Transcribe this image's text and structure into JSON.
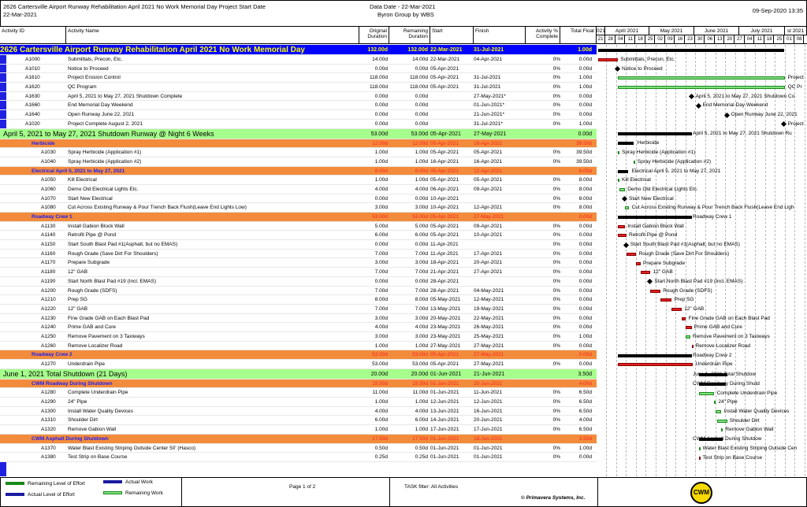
{
  "header": {
    "title": "2626 Cartersville Airport Runway Rehabilitation April 2021 No Work Memorial Day Project Start Date",
    "start_date": "22-Mar-2021",
    "data_date": "Data Date - 22-Mar-2021",
    "group": "Byron Group by WBS",
    "run_date": "09-Sep-2020 13:35"
  },
  "columns": {
    "id": "Activity ID",
    "name": "Activity Name",
    "orig": "Original Duration",
    "rem": "Remaining Duration",
    "start": "Start",
    "finish": "Finish",
    "pct": "Activity % Complete",
    "tf": "Total Float"
  },
  "timeline": {
    "months": [
      "021",
      "April 2021",
      "May 2021",
      "June 2021",
      "July 2021",
      "st 2021"
    ],
    "days": [
      "21",
      "28",
      "04",
      "11",
      "18",
      "25",
      "02",
      "09",
      "16",
      "23",
      "30",
      "06",
      "13",
      "20",
      "27",
      "04",
      "11",
      "18",
      "25",
      "01",
      "08"
    ]
  },
  "rows": [
    {
      "type": "proj",
      "id": "2626 Cartersville Airport Runway Rehabilitation April 2021 No Work Memorial Day",
      "od": "132.00d",
      "rd": "132.00d",
      "st": "22-Mar-2021",
      "fn": "31-Jul-2021",
      "pc": "",
      "tf": "1.00d"
    },
    {
      "type": "act",
      "id": "A1000",
      "nm": "Submittals, Precon, Etc.",
      "od": "14.00d",
      "rd": "14.00d",
      "st": "22-Mar-2021",
      "fn": "04-Apr-2021",
      "pc": "0%",
      "tf": "0.00d"
    },
    {
      "type": "act",
      "id": "A1010",
      "nm": "Notice to Proceed",
      "od": "0.00d",
      "rd": "0.00d",
      "st": "05-Apr-2021",
      "fn": "",
      "pc": "0%",
      "tf": "0.00d"
    },
    {
      "type": "act",
      "id": "A1610",
      "nm": "Project Erosion Control",
      "od": "118.00d",
      "rd": "118.00d",
      "st": "05-Apr-2021",
      "fn": "31-Jul-2021",
      "pc": "0%",
      "tf": "1.00d"
    },
    {
      "type": "act",
      "id": "A1620",
      "nm": "QC Program",
      "od": "118.00d",
      "rd": "118.00d",
      "st": "05-Apr-2021",
      "fn": "31-Jul-2021",
      "pc": "0%",
      "tf": "1.00d"
    },
    {
      "type": "act",
      "id": "A1630",
      "nm": "April 5, 2021 to May 27, 2021 Shutdown Complete",
      "od": "0.00d",
      "rd": "0.00d",
      "st": "",
      "fn": "27-May-2021*",
      "pc": "0%",
      "tf": "0.00d"
    },
    {
      "type": "act",
      "id": "A1660",
      "nm": "End Memorial Day Weekend",
      "od": "0.00d",
      "rd": "0.00d",
      "st": "",
      "fn": "01-Jun-2021*",
      "pc": "0%",
      "tf": "0.00d"
    },
    {
      "type": "act",
      "id": "A1640",
      "nm": "Open Runway June 22, 2021",
      "od": "0.00d",
      "rd": "0.00d",
      "st": "",
      "fn": "21-Jun-2021*",
      "pc": "0%",
      "tf": "0.00d"
    },
    {
      "type": "act",
      "id": "A1020",
      "nm": "Project Complete August 2, 2021",
      "od": "0.00d",
      "rd": "0.00d",
      "st": "",
      "fn": "31-Jul-2021*",
      "pc": "0%",
      "tf": "1.00d"
    },
    {
      "type": "l1",
      "id": "April 5, 2021 to May 27, 2021 Shutdown Runway @ Night 6 Weeks",
      "od": "53.00d",
      "rd": "53.00d",
      "st": "05-Apr-2021",
      "fn": "27-May-2021",
      "pc": "",
      "tf": "0.00d"
    },
    {
      "type": "l2",
      "id": "Herbicide",
      "od": "12.00d",
      "rd": "12.00d",
      "st": "05-Apr-2021",
      "fn": "16-Apr-2021",
      "pc": "",
      "tf": "39.50d"
    },
    {
      "type": "act2",
      "id": "A1030",
      "nm": "Spray Herbicide (Application #1)",
      "od": "1.00d",
      "rd": "1.00d",
      "st": "05-Apr-2021",
      "fn": "05-Apr-2021",
      "pc": "0%",
      "tf": "39.50d"
    },
    {
      "type": "act2",
      "id": "A1040",
      "nm": "Spray Herbicide (Application #2)",
      "od": "1.00d",
      "rd": "1.00d",
      "st": "16-Apr-2021",
      "fn": "16-Apr-2021",
      "pc": "0%",
      "tf": "39.50d"
    },
    {
      "type": "l2",
      "id": "Electrical April 5, 2021 to May 27, 2021",
      "od": "8.00d",
      "rd": "8.00d",
      "st": "05-Apr-2021",
      "fn": "12-Apr-2021",
      "pc": "",
      "tf": "8.00d"
    },
    {
      "type": "act2",
      "id": "A1050",
      "nm": "Kill Electrical",
      "od": "1.00d",
      "rd": "1.00d",
      "st": "05-Apr-2021",
      "fn": "05-Apr-2021",
      "pc": "0%",
      "tf": "8.00d"
    },
    {
      "type": "act2",
      "id": "A1060",
      "nm": "Demo Old Electrical Lights Etc.",
      "od": "4.00d",
      "rd": "4.00d",
      "st": "06-Apr-2021",
      "fn": "09-Apr-2021",
      "pc": "0%",
      "tf": "8.00d"
    },
    {
      "type": "act2",
      "id": "A1070",
      "nm": "Start New Electrical",
      "od": "0.00d",
      "rd": "0.00d",
      "st": "10-Apr-2021",
      "fn": "",
      "pc": "0%",
      "tf": "8.00d"
    },
    {
      "type": "act2",
      "id": "A1080",
      "nm": "Cut Across Existing Runway & Pour Trench Back Flush(Leave End Lights Low)",
      "od": "3.00d",
      "rd": "3.00d",
      "st": "10-Apr-2021",
      "fn": "12-Apr-2021",
      "pc": "0%",
      "tf": "8.00d"
    },
    {
      "type": "l2",
      "id": "Roadway Crew 1",
      "od": "53.00d",
      "rd": "53.00d",
      "st": "05-Apr-2021",
      "fn": "27-May-2021",
      "pc": "",
      "tf": "0.00d"
    },
    {
      "type": "act2",
      "id": "A1130",
      "nm": "Install Gabion Block Wall",
      "od": "5.00d",
      "rd": "5.00d",
      "st": "05-Apr-2021",
      "fn": "09-Apr-2021",
      "pc": "0%",
      "tf": "0.00d"
    },
    {
      "type": "act2",
      "id": "A1140",
      "nm": "Retrofit Pipe @ Pond",
      "od": "6.00d",
      "rd": "6.00d",
      "st": "05-Apr-2021",
      "fn": "10-Apr-2021",
      "pc": "0%",
      "tf": "0.00d"
    },
    {
      "type": "act2",
      "id": "A1150",
      "nm": "Start South Blast Pad #1(Asphalt, but no EMAS)",
      "od": "0.00d",
      "rd": "0.00d",
      "st": "11-Apr-2021",
      "fn": "",
      "pc": "0%",
      "tf": "0.00d"
    },
    {
      "type": "act2",
      "id": "A1160",
      "nm": "Rough Grade (Save Dirt For Shoulders)",
      "od": "7.00d",
      "rd": "7.00d",
      "st": "11-Apr-2021",
      "fn": "17-Apr-2021",
      "pc": "0%",
      "tf": "0.00d"
    },
    {
      "type": "act2",
      "id": "A1170",
      "nm": "Prepare Subgrade",
      "od": "3.00d",
      "rd": "3.00d",
      "st": "18-Apr-2021",
      "fn": "20-Apr-2021",
      "pc": "0%",
      "tf": "0.00d"
    },
    {
      "type": "act2",
      "id": "A1180",
      "nm": "12\" GAB",
      "od": "7.00d",
      "rd": "7.00d",
      "st": "21-Apr-2021",
      "fn": "27-Apr-2021",
      "pc": "0%",
      "tf": "0.00d"
    },
    {
      "type": "act2",
      "id": "A1190",
      "nm": "Start North Blast Pad #19 (Incl. EMAS)",
      "od": "0.00d",
      "rd": "0.00d",
      "st": "28-Apr-2021",
      "fn": "",
      "pc": "0%",
      "tf": "0.00d"
    },
    {
      "type": "act2",
      "id": "A1200",
      "nm": "Rough Grade (SDFS)",
      "od": "7.00d",
      "rd": "7.00d",
      "st": "28-Apr-2021",
      "fn": "04-May-2021",
      "pc": "0%",
      "tf": "0.00d"
    },
    {
      "type": "act2",
      "id": "A1210",
      "nm": "Prep SG",
      "od": "8.00d",
      "rd": "8.00d",
      "st": "05-May-2021",
      "fn": "12-May-2021",
      "pc": "0%",
      "tf": "0.00d"
    },
    {
      "type": "act2",
      "id": "A1220",
      "nm": "12\" GAB",
      "od": "7.00d",
      "rd": "7.00d",
      "st": "13-May-2021",
      "fn": "19-May-2021",
      "pc": "0%",
      "tf": "0.00d"
    },
    {
      "type": "act2",
      "id": "A1230",
      "nm": "Fine Grade GAB on Each Blast Pad",
      "od": "3.00d",
      "rd": "3.00d",
      "st": "20-May-2021",
      "fn": "22-May-2021",
      "pc": "0%",
      "tf": "0.00d"
    },
    {
      "type": "act2",
      "id": "A1240",
      "nm": "Prime GAB and Cure",
      "od": "4.00d",
      "rd": "4.00d",
      "st": "23-May-2021",
      "fn": "26-May-2021",
      "pc": "0%",
      "tf": "0.00d"
    },
    {
      "type": "act2",
      "id": "A1250",
      "nm": "Remove Pavement on 3 Taxiways",
      "od": "3.00d",
      "rd": "3.00d",
      "st": "23-May-2021",
      "fn": "25-May-2021",
      "pc": "0%",
      "tf": "1.00d"
    },
    {
      "type": "act2",
      "id": "A1260",
      "nm": "Remove Localizer Road",
      "od": "1.00d",
      "rd": "1.00d",
      "st": "27-May-2021",
      "fn": "27-May-2021",
      "pc": "0%",
      "tf": "0.00d"
    },
    {
      "type": "l2",
      "id": "Roadway Crew 2",
      "od": "53.00d",
      "rd": "53.00d",
      "st": "05-Apr-2021",
      "fn": "27-May-2021",
      "pc": "",
      "tf": "0.00d"
    },
    {
      "type": "act2",
      "id": "A1270",
      "nm": "Underdrain Pipe",
      "od": "53.00d",
      "rd": "53.00d",
      "st": "05-Apr-2021",
      "fn": "27-May-2021",
      "pc": "0%",
      "tf": "0.00d"
    },
    {
      "type": "l1",
      "id": "June 1, 2021 Total Shutdown (21 Days)",
      "od": "20.00d",
      "rd": "20.00d",
      "st": "01-Jun-2021",
      "fn": "21-Jun-2021",
      "pc": "",
      "tf": "3.50d"
    },
    {
      "type": "l2",
      "id": "CWM Roadway During Shutdown",
      "od": "19.50d",
      "rd": "19.50d",
      "st": "01-Jun-2021",
      "fn": "20-Jun-2021",
      "pc": "",
      "tf": "4.00d"
    },
    {
      "type": "act2",
      "id": "A1280",
      "nm": "Complete Underdrain Pipe",
      "od": "11.00d",
      "rd": "11.00d",
      "st": "01-Jun-2021",
      "fn": "11-Jun-2021",
      "pc": "0%",
      "tf": "6.50d"
    },
    {
      "type": "act2",
      "id": "A1290",
      "nm": "24\" Pipe",
      "od": "1.00d",
      "rd": "1.00d",
      "st": "12-Jun-2021",
      "fn": "12-Jun-2021",
      "pc": "0%",
      "tf": "6.50d"
    },
    {
      "type": "act2",
      "id": "A1300",
      "nm": "Install Water Quality Devices",
      "od": "4.00d",
      "rd": "4.00d",
      "st": "13-Jun-2021",
      "fn": "16-Jun-2021",
      "pc": "0%",
      "tf": "6.50d"
    },
    {
      "type": "act2",
      "id": "A1310",
      "nm": "Shoulder Dirt",
      "od": "6.00d",
      "rd": "6.00d",
      "st": "14-Jun-2021",
      "fn": "20-Jun-2021",
      "pc": "0%",
      "tf": "4.00d"
    },
    {
      "type": "act2",
      "id": "A1320",
      "nm": "Remove Gabion Wall",
      "od": "1.00d",
      "rd": "1.00d",
      "st": "17-Jun-2021",
      "fn": "17-Jun-2021",
      "pc": "0%",
      "tf": "6.50d"
    },
    {
      "type": "l2",
      "id": "CWM Asphalt During Shutdown",
      "od": "17.50d",
      "rd": "17.50d",
      "st": "01-Jun-2021",
      "fn": "18-Jun-2021",
      "pc": "",
      "tf": "3.50d"
    },
    {
      "type": "act2",
      "id": "A1370",
      "nm": "Water Blast Existing Striping Outside Center 50' (Hasco)",
      "od": "0.50d",
      "rd": "0.50d",
      "st": "01-Jun-2021",
      "fn": "01-Jun-2021",
      "pc": "0%",
      "tf": "1.00d"
    },
    {
      "type": "act2",
      "id": "A1380",
      "nm": "Test Strip on Base Course",
      "od": "0.25d",
      "rd": "0.25d",
      "st": "01-Jun-2021",
      "fn": "01-Jun-2021",
      "pc": "0%",
      "tf": "0.00d"
    }
  ],
  "gantt_labels": [
    {
      "row": 1,
      "text": "Submittals, Precon, Etc."
    },
    {
      "row": 2,
      "text": "Notice to Proceed"
    },
    {
      "row": 3,
      "text": "Project"
    },
    {
      "row": 4,
      "text": "QC Pr"
    },
    {
      "row": 5,
      "text": "April 5, 2021 to May 27, 2021 Shutdown Co"
    },
    {
      "row": 6,
      "text": "End Memorial Day Weekend"
    },
    {
      "row": 7,
      "text": "Open Runway June 22, 2021"
    },
    {
      "row": 8,
      "text": "Project"
    },
    {
      "row": 9,
      "text": "April 5, 2021 to May 27, 2021 Shutdown Ru"
    },
    {
      "row": 10,
      "text": "Herbicide"
    },
    {
      "row": 11,
      "text": "Spray Herbicide (Application #1)"
    },
    {
      "row": 12,
      "text": "Spray Herbicide (Application #2)"
    },
    {
      "row": 13,
      "text": "Electrical April 5, 2021 to May 27, 2021"
    },
    {
      "row": 14,
      "text": "Kill Electrical"
    },
    {
      "row": 15,
      "text": "Demo Old Electrical Lights Etc."
    },
    {
      "row": 16,
      "text": "Start New Electrical"
    },
    {
      "row": 17,
      "text": "Cut Across Existing Runway & Pour Trench Back Flush(Leave End Ligh"
    },
    {
      "row": 18,
      "text": "Roadway Crew 1"
    },
    {
      "row": 19,
      "text": "Install Gabion Block Wall"
    },
    {
      "row": 20,
      "text": "Retrofit Pipe @ Pond"
    },
    {
      "row": 21,
      "text": "Start South Blast Pad #1(Asphalt, but no EMAS)"
    },
    {
      "row": 22,
      "text": "Rough Grade (Save Dirt For Shoulders)"
    },
    {
      "row": 23,
      "text": "Prepare Subgrade"
    },
    {
      "row": 24,
      "text": "12\" GAB"
    },
    {
      "row": 25,
      "text": "Start North Blast Pad #19 (Incl. EMAS)"
    },
    {
      "row": 26,
      "text": "Rough Grade (SDFS)"
    },
    {
      "row": 27,
      "text": "Prep SG"
    },
    {
      "row": 28,
      "text": "12\" GAB"
    },
    {
      "row": 29,
      "text": "Fine Grade GAB on Each Blast Pad"
    },
    {
      "row": 30,
      "text": "Prime GAB and Cure"
    },
    {
      "row": 31,
      "text": "Remove Pavement on 3 Taxiways"
    },
    {
      "row": 32,
      "text": "Remove Localizer Road"
    },
    {
      "row": 33,
      "text": "Roadway Crew 2"
    },
    {
      "row": 34,
      "text": "Underdrain Pipe"
    },
    {
      "row": 35,
      "text": "June 1, 2021 Total Shutdow"
    },
    {
      "row": 36,
      "text": "CWM Roadway During Shutd"
    },
    {
      "row": 37,
      "text": "Complete Underdrain Pipe"
    },
    {
      "row": 38,
      "text": "24\" Pipe"
    },
    {
      "row": 39,
      "text": "Install Water Quality Devices"
    },
    {
      "row": 40,
      "text": "Shoulder Dirt"
    },
    {
      "row": 41,
      "text": "Remove Gabion Wall"
    },
    {
      "row": 42,
      "text": "CWM Asphalt During Shutdow"
    },
    {
      "row": 43,
      "text": "Water Blast Existing Striping Outside Cen"
    },
    {
      "row": 44,
      "text": "Test Strip on Base Course"
    }
  ],
  "footer": {
    "legend": {
      "rlle": "Remaining Level of Effort",
      "actual_work": "Actual Work",
      "alle": "Actual Level of Effort",
      "remaining_work": "Remaining Work"
    },
    "page": "Page 1 of 2",
    "filter": "TASK filter: All Activities",
    "copyright": "© Primavera Systems, Inc.",
    "logo_text": "CWM"
  },
  "colors": {
    "project_band": "#0000ff",
    "project_text": "#ffff00",
    "level1": "#a6ff8c",
    "level2": "#f28c3c",
    "critical_bar": "#e02020",
    "normal_bar": "#7fe07f",
    "summary_bar": "#000000"
  }
}
